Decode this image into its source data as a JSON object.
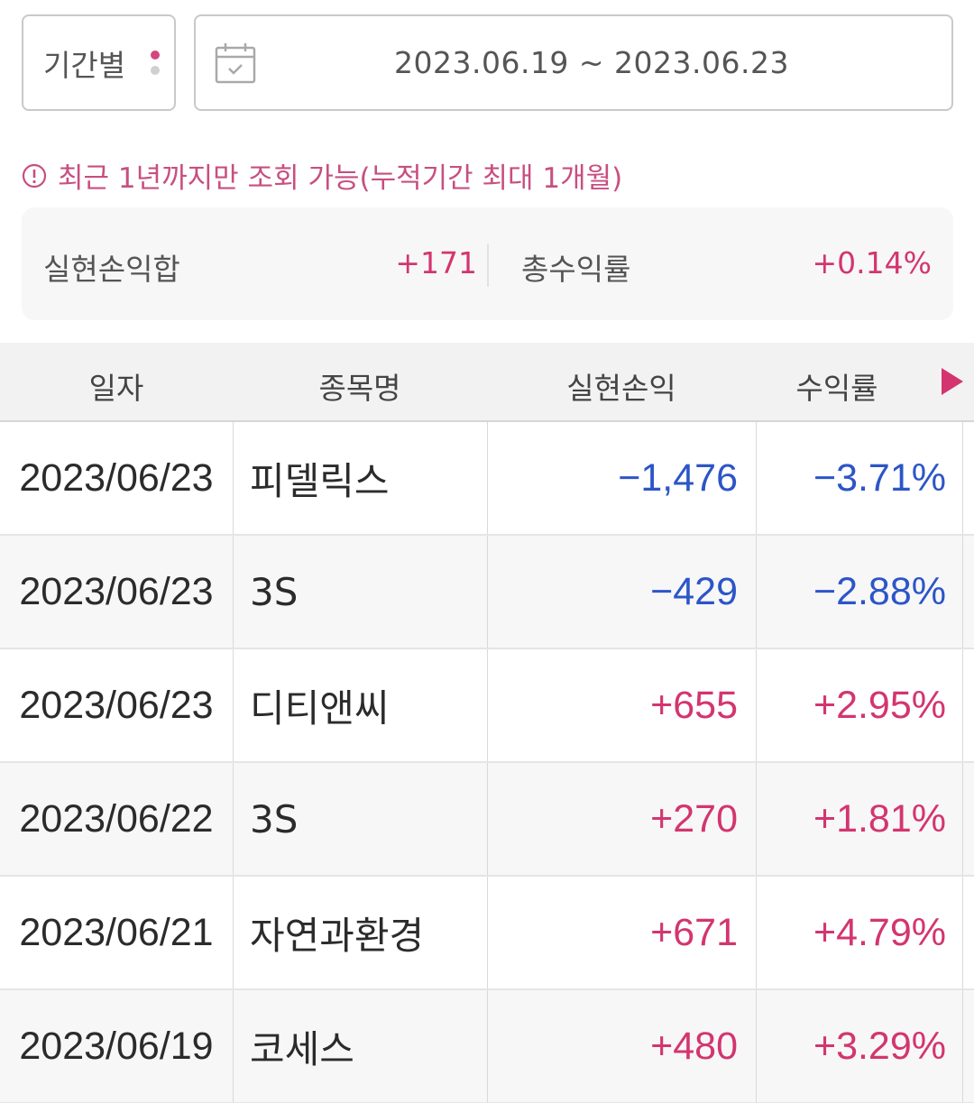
{
  "filter": {
    "period_label": "기간별",
    "date_range": "2023.06.19 ~ 2023.06.23"
  },
  "notice": "최근 1년까지만 조회 가능(누적기간 최대 1개월)",
  "summary": {
    "realized_pl_label": "실현손익합",
    "realized_pl_value": "+171",
    "total_return_label": "총수익률",
    "total_return_value": "+0.14%"
  },
  "table": {
    "headers": [
      "일자",
      "종목명",
      "실현손익",
      "수익률"
    ],
    "rows": [
      {
        "date": "2023/06/23",
        "name": "피델릭스",
        "pl": "−1,476",
        "rate": "−3.71%",
        "sign": "neg"
      },
      {
        "date": "2023/06/23",
        "name": "3S",
        "pl": "−429",
        "rate": "−2.88%",
        "sign": "neg"
      },
      {
        "date": "2023/06/23",
        "name": "디티앤씨",
        "pl": "+655",
        "rate": "+2.95%",
        "sign": "pos"
      },
      {
        "date": "2023/06/22",
        "name": "3S",
        "pl": "+270",
        "rate": "+1.81%",
        "sign": "pos"
      },
      {
        "date": "2023/06/21",
        "name": "자연과환경",
        "pl": "+671",
        "rate": "+4.79%",
        "sign": "pos"
      },
      {
        "date": "2023/06/19",
        "name": "코세스",
        "pl": "+480",
        "rate": "+3.29%",
        "sign": "pos"
      }
    ]
  },
  "colors": {
    "positive": "#d3356f",
    "negative": "#2c55c8",
    "accent": "#d4467e"
  },
  "icons": {
    "calendar": "calendar-icon",
    "notice": "info-circle-icon",
    "scroll": "triangle-right-icon"
  }
}
